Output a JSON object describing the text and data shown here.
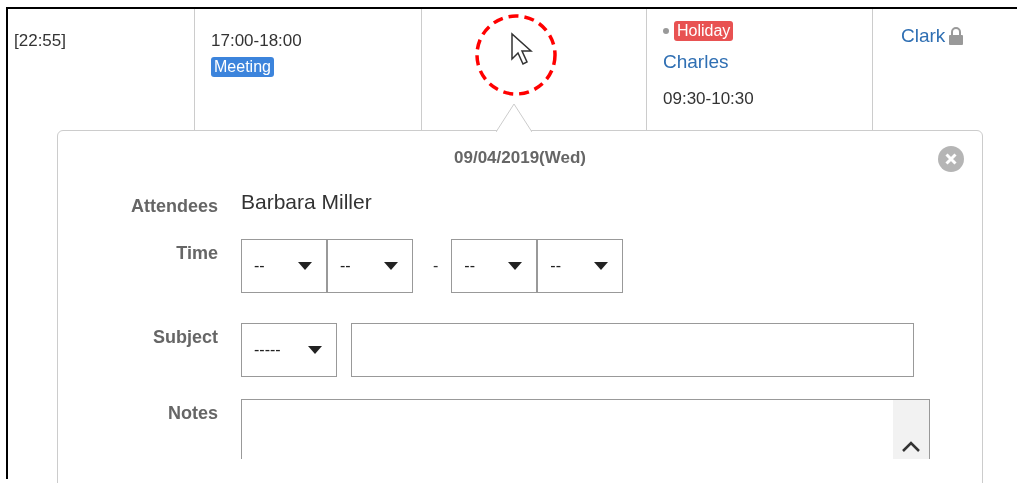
{
  "calendar": {
    "columns": [
      {
        "items": [
          {
            "kind": "time",
            "text": "[22:55]"
          }
        ]
      },
      {
        "items": [
          {
            "kind": "time",
            "text": "17:00-18:00"
          },
          {
            "kind": "tag",
            "text": "Meeting",
            "color": "#3c84dc",
            "bullet": false
          }
        ]
      },
      {},
      {
        "items": [
          {
            "kind": "tag",
            "text": "Holiday",
            "color": "#e85252",
            "bullet": true
          },
          {
            "kind": "link",
            "text": "Charles",
            "locked": false
          },
          {
            "kind": "time",
            "text": "09:30-10:30"
          }
        ]
      },
      {
        "items": [
          {
            "kind": "link",
            "text": "Clark",
            "locked": true
          }
        ]
      }
    ]
  },
  "popup": {
    "date": "09/04/2019(Wed)",
    "fields": [
      {
        "kind": "text",
        "label": "Attendees",
        "value": "Barbara Miller"
      },
      {
        "kind": "time",
        "label": "Time",
        "selects": [
          "--",
          "--",
          "--",
          "--"
        ],
        "separator": "-"
      },
      {
        "kind": "subject",
        "label": "Subject",
        "select": "-----"
      },
      {
        "kind": "notes",
        "label": "Notes"
      }
    ]
  }
}
